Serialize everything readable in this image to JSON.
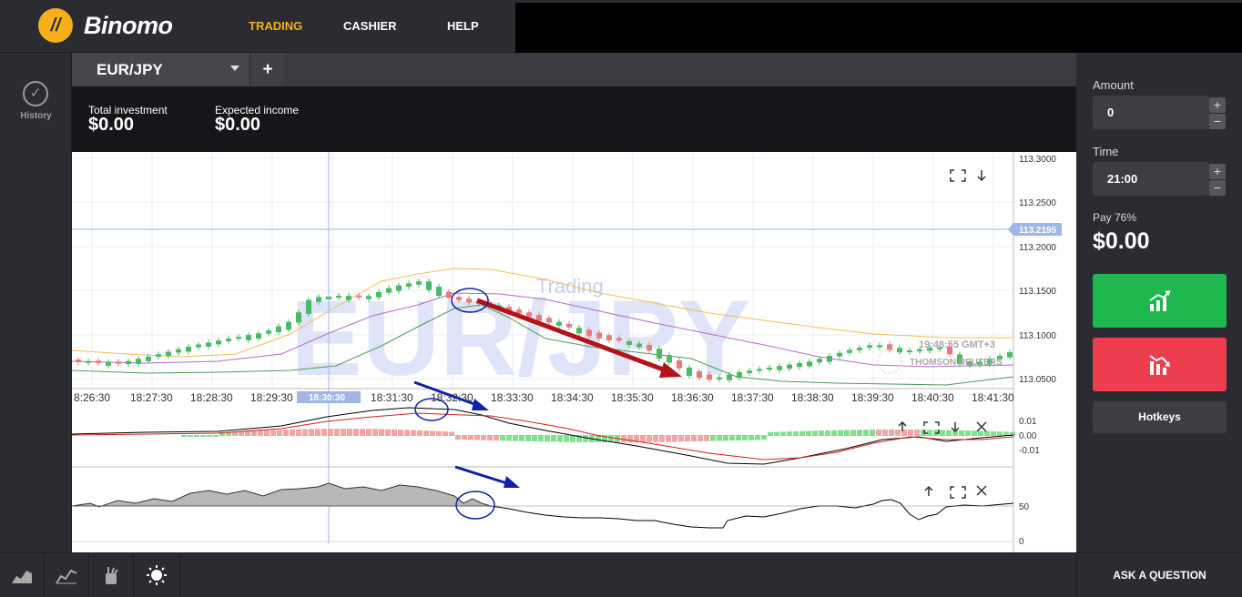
{
  "brand": {
    "name": "Binomo"
  },
  "nav": {
    "trading": "TRADING",
    "cashier": "CASHIER",
    "help": "HELP"
  },
  "sidebar": {
    "history_label": "History"
  },
  "tab": {
    "asset": "EUR/JPY"
  },
  "investment": {
    "total_label": "Total investment",
    "total_value": "$0.00",
    "income_label": "Expected income",
    "income_value": "$0.00"
  },
  "chart": {
    "watermark_asset": "EUR/JPY",
    "watermark_mode": "Trading",
    "server_time": "19:48:55 GMT+3",
    "provider": "THOMSON REUTERS",
    "current_price": "113.2195",
    "crosshair_time": "18:30:30",
    "price_ticks": [
      "113.3000",
      "113.2500",
      "113.2000",
      "113.1500",
      "113.1000",
      "113.0500"
    ],
    "time_ticks": [
      "8:26:30",
      "18:27:30",
      "18:28:30",
      "18:29:30",
      "18:30:30",
      "18:31:30",
      "18:32:30",
      "18:33:30",
      "18:34:30",
      "18:35:30",
      "18:36:30",
      "18:37:30",
      "18:38:30",
      "18:39:30",
      "18:40:30",
      "18:41:30"
    ],
    "macd_ticks": [
      "0.01",
      "0.00",
      "-0.01"
    ],
    "rsi_ticks": [
      "50",
      "0"
    ]
  },
  "trade": {
    "amount_label": "Amount",
    "amount_value": "0",
    "time_label": "Time",
    "time_value": "21:00",
    "pay_label": "Pay 76%",
    "pay_value": "$0.00",
    "hotkeys_label": "Hotkeys"
  },
  "footer": {
    "ask_label": "ASK A QUESTION"
  },
  "colors": {
    "accent": "#f5b01c",
    "up": "#1eb84e",
    "down": "#ec3e4f",
    "arrow_red": "#b3121b",
    "arrow_blue": "#0d22a8"
  }
}
